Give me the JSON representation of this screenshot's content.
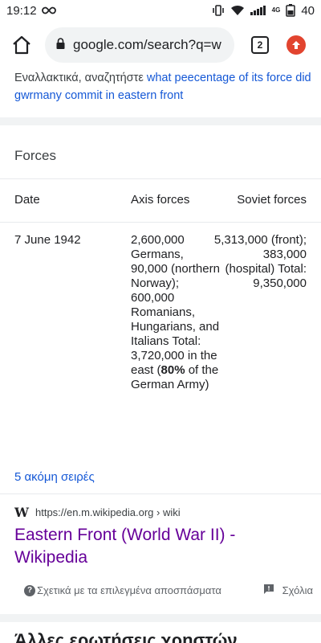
{
  "status_bar": {
    "time": "19:12",
    "network": "4G",
    "battery": "40"
  },
  "browser": {
    "url": "google.com/search?q=w",
    "tab_count": "2"
  },
  "alt_search": {
    "prefix": "Εναλλακτικά, αναζητήστε ",
    "link": "what peecentage of its force did gwrmany commit in eastern front"
  },
  "forces": {
    "title": "Forces",
    "headers": {
      "date": "Date",
      "axis": "Axis forces",
      "soviet": "Soviet forces"
    },
    "row": {
      "date": "7 June 1942",
      "axis_before_bold": "2,600,000 Germans, 90,000 (northern Norway); 600,000 Romanians, Hungarians, and Italians Total: 3,720,000 in the east (",
      "axis_bold": "80%",
      "axis_after_bold": " of the German Army)",
      "soviet": "5,313,000 (front); 383,000 (hospital) Total: 9,350,000"
    },
    "more_rows": "5 ακόμη σειρές"
  },
  "result": {
    "logo": "W",
    "url": "https://en.m.wikipedia.org › wiki",
    "title": "Eastern Front (World War II) - Wikipedia",
    "about": "Σχετικά με τα επιλεγμένα αποσπάσματα",
    "feedback": "Σχόλια"
  },
  "next_section_peek": "Άλλες ερωτήσεις χρηστών"
}
